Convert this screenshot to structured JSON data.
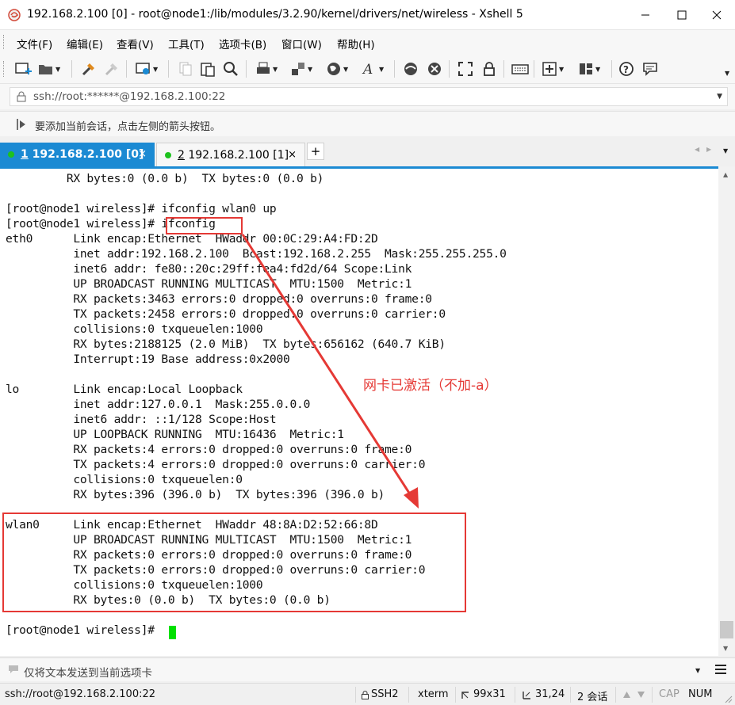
{
  "window": {
    "title": "192.168.2.100 [0] - root@node1:/lib/modules/3.2.90/kernel/drivers/net/wireless - Xshell 5"
  },
  "menu": [
    "文件(F)",
    "编辑(E)",
    "查看(V)",
    "工具(T)",
    "选项卡(B)",
    "窗口(W)",
    "帮助(H)"
  ],
  "address": {
    "value": "ssh://root:******@192.168.2.100:22"
  },
  "hint": {
    "text": "要添加当前会话，点击左侧的箭头按钮。"
  },
  "tabs": [
    {
      "number": "1",
      "label": " 192.168.2.100 [0]",
      "close": "×",
      "active": true
    },
    {
      "number": "2",
      "label": " 192.168.2.100 [1]",
      "close": "×",
      "active": false
    }
  ],
  "tab_add": "+",
  "terminal": {
    "lines": [
      "         RX bytes:0 (0.0 b)  TX bytes:0 (0.0 b)",
      "",
      "[root@node1 wireless]# ifconfig wlan0 up",
      "[root@node1 wireless]# ifconfig",
      "eth0      Link encap:Ethernet  HWaddr 00:0C:29:A4:FD:2D",
      "          inet addr:192.168.2.100  Bcast:192.168.2.255  Mask:255.255.255.0",
      "          inet6 addr: fe80::20c:29ff:fea4:fd2d/64 Scope:Link",
      "          UP BROADCAST RUNNING MULTICAST  MTU:1500  Metric:1",
      "          RX packets:3463 errors:0 dropped:0 overruns:0 frame:0",
      "          TX packets:2458 errors:0 dropped:0 overruns:0 carrier:0",
      "          collisions:0 txqueuelen:1000",
      "          RX bytes:2188125 (2.0 MiB)  TX bytes:656162 (640.7 KiB)",
      "          Interrupt:19 Base address:0x2000",
      "",
      "lo        Link encap:Local Loopback",
      "          inet addr:127.0.0.1  Mask:255.0.0.0",
      "          inet6 addr: ::1/128 Scope:Host",
      "          UP LOOPBACK RUNNING  MTU:16436  Metric:1",
      "          RX packets:4 errors:0 dropped:0 overruns:0 frame:0",
      "          TX packets:4 errors:0 dropped:0 overruns:0 carrier:0",
      "          collisions:0 txqueuelen:0",
      "          RX bytes:396 (396.0 b)  TX bytes:396 (396.0 b)",
      "",
      "wlan0     Link encap:Ethernet  HWaddr 48:8A:D2:52:66:8D",
      "          UP BROADCAST RUNNING MULTICAST  MTU:1500  Metric:1",
      "          RX packets:0 errors:0 dropped:0 overruns:0 frame:0",
      "          TX packets:0 errors:0 dropped:0 overruns:0 carrier:0",
      "          collisions:0 txqueuelen:1000",
      "          RX bytes:0 (0.0 b)  TX bytes:0 (0.0 b)",
      "",
      "[root@node1 wireless]# "
    ],
    "annotation": "网卡已激活（不加-a）",
    "cursor_color": "#00e000"
  },
  "compose": {
    "text": "仅将文本发送到当前选项卡"
  },
  "status": {
    "connection": "ssh://root@192.168.2.100:22",
    "protocol": "SSH2",
    "term": "xterm",
    "size": "99x31",
    "position": "31,24",
    "sessions": "2 会话",
    "cap": "CAP",
    "num": "NUM"
  },
  "colors": {
    "accent": "#1b8ad3",
    "annotation": "#e53935",
    "session_dot": "#1ec21e"
  },
  "icons": [
    "xshell-logo-icon",
    "minimize-icon",
    "maximize-icon",
    "close-icon",
    "new-session-icon",
    "open-folder-icon",
    "reconnect-icon",
    "disconnect-icon",
    "properties-icon",
    "copy-icon",
    "paste-icon",
    "find-icon",
    "print-icon",
    "transfer-icon",
    "globe-icon",
    "font-icon",
    "xftp-icon",
    "xmanager-icon",
    "fullscreen-icon",
    "lock-icon",
    "keyboard-icon",
    "add-icon",
    "layout-icon",
    "help-icon",
    "chat-icon"
  ]
}
